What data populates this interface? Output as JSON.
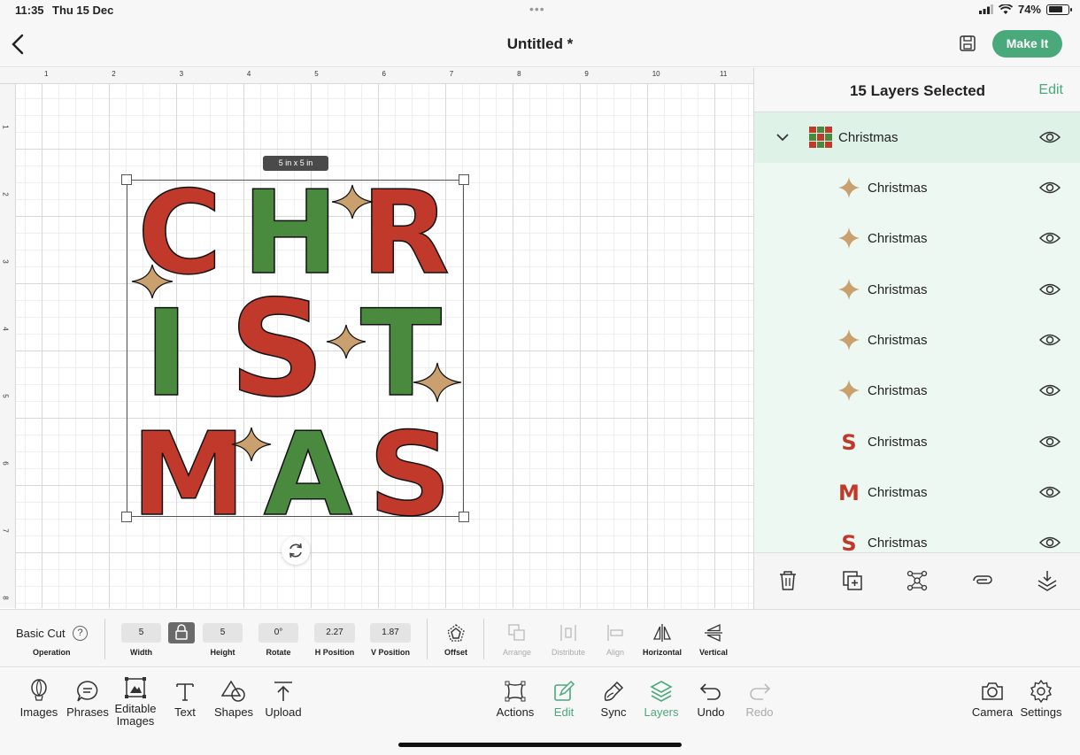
{
  "status": {
    "time": "11:35",
    "date": "Thu 15 Dec",
    "battery": "74%",
    "battery_level": 0.74
  },
  "header": {
    "title": "Untitled *",
    "make_it": "Make It"
  },
  "ruler": {
    "h": [
      "1",
      "2",
      "3",
      "4",
      "5",
      "6",
      "7",
      "8",
      "9",
      "10",
      "11"
    ],
    "v": [
      "1",
      "2",
      "3",
      "4",
      "5",
      "6",
      "7",
      "8"
    ]
  },
  "canvas": {
    "size_tag": "5 in x 5 in",
    "design_text": [
      "CHR",
      "IST",
      "MAS"
    ]
  },
  "panel": {
    "title": "15 Layers Selected",
    "edit": "Edit",
    "group": {
      "name": "Christmas"
    },
    "layers": [
      {
        "name": "Christmas",
        "thumb": "star"
      },
      {
        "name": "Christmas",
        "thumb": "star"
      },
      {
        "name": "Christmas",
        "thumb": "star"
      },
      {
        "name": "Christmas",
        "thumb": "star"
      },
      {
        "name": "Christmas",
        "thumb": "star"
      },
      {
        "name": "Christmas",
        "thumb": "S"
      },
      {
        "name": "Christmas",
        "thumb": "M"
      },
      {
        "name": "Christmas",
        "thumb": "S"
      }
    ]
  },
  "props": {
    "operation": "Basic Cut",
    "operation_label": "Operation",
    "help": "?",
    "width": "5",
    "width_label": "Width",
    "height": "5",
    "height_label": "Height",
    "rotate": "0°",
    "rotate_label": "Rotate",
    "hpos": "2.27",
    "hpos_label": "H Position",
    "vpos": "1.87",
    "vpos_label": "V Position",
    "offset": "Offset",
    "arrange": "Arrange",
    "distribute": "Distribute",
    "align": "Align",
    "horizontal": "Horizontal",
    "vertical": "Vertical"
  },
  "bottom": {
    "images": "Images",
    "phrases": "Phrases",
    "editable_images": "Editable Images",
    "text": "Text",
    "shapes": "Shapes",
    "upload": "Upload",
    "actions": "Actions",
    "edit": "Edit",
    "sync": "Sync",
    "layers": "Layers",
    "undo": "Undo",
    "redo": "Redo",
    "camera": "Camera",
    "settings": "Settings"
  },
  "colors": {
    "accent": "#4aa97b",
    "red": "#c0392b",
    "green": "#4a8a3f",
    "tan": "#c9a06e"
  }
}
